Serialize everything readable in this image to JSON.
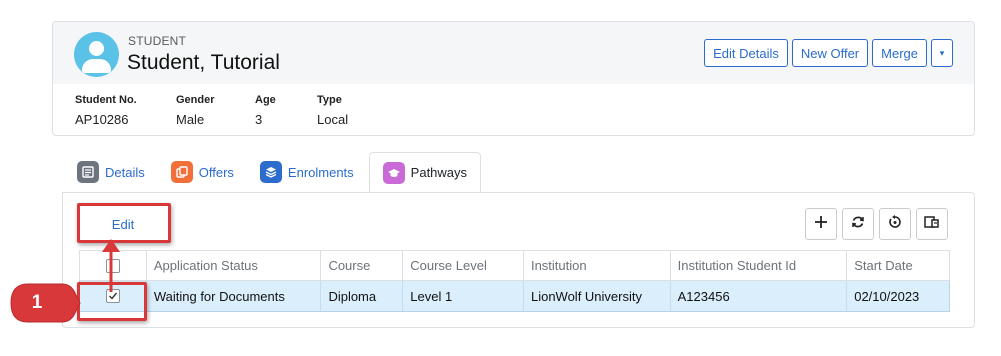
{
  "student": {
    "kind_label": "STUDENT",
    "name": "Student, Tutorial",
    "actions": {
      "edit_details": "Edit Details",
      "new_offer": "New Offer",
      "merge": "Merge",
      "caret": "▾"
    },
    "fields": [
      {
        "label": "Student No.",
        "value": "AP10286"
      },
      {
        "label": "Gender",
        "value": "Male"
      },
      {
        "label": "Age",
        "value": "3"
      },
      {
        "label": "Type",
        "value": "Local"
      }
    ]
  },
  "tabs": [
    {
      "label": "Details",
      "icon": "details-icon",
      "color": "#6c757d",
      "active": false
    },
    {
      "label": "Offers",
      "icon": "offers-icon",
      "color": "#f26f3a",
      "active": false
    },
    {
      "label": "Enrolments",
      "icon": "enrolments-icon",
      "color": "#2b6ccc",
      "active": false
    },
    {
      "label": "Pathways",
      "icon": "pathways-icon",
      "color": "#c96ad6",
      "active": true
    }
  ],
  "toolbar": {
    "edit_label": "Edit",
    "tools": [
      "add-icon",
      "refresh-icon",
      "reset-icon",
      "columns-icon"
    ]
  },
  "grid": {
    "columns": [
      "",
      "Application Status",
      "Course",
      "Course Level",
      "Institution",
      "Institution Student Id",
      "Start Date"
    ],
    "rows": [
      {
        "selected": true,
        "cells": [
          "",
          "Waiting for Documents",
          "Diploma",
          "Level 1",
          "LionWolf University",
          "A123456",
          "02/10/2023"
        ]
      }
    ]
  },
  "annotation": {
    "step": "1",
    "highlight_color": "#d9383a"
  }
}
